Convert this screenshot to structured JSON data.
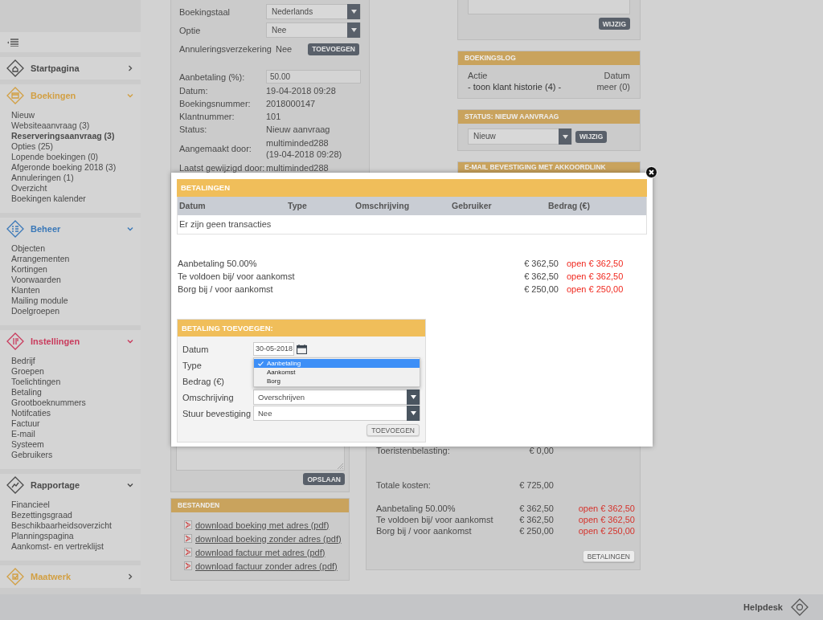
{
  "sidebar": {
    "sections": [
      {
        "title": "Startpagina",
        "color": "#4a4a4a",
        "expanded": false
      },
      {
        "title": "Boekingen",
        "color": "#d29f42",
        "expanded": true,
        "items": [
          {
            "label": "Nieuw",
            "selected": false
          },
          {
            "label": "Websiteaanvraag (3)",
            "selected": false
          },
          {
            "label": "Reserveringsaanvraag (3)",
            "selected": true
          },
          {
            "label": "Opties (25)",
            "selected": false
          },
          {
            "label": "Lopende boekingen (0)",
            "selected": false
          },
          {
            "label": "Afgeronde boeking 2018 (3)",
            "selected": false
          },
          {
            "label": "Annuleringen (1)",
            "selected": false
          },
          {
            "label": "Overzicht",
            "selected": false
          },
          {
            "label": "Boekingen kalender",
            "selected": false
          }
        ]
      },
      {
        "title": "Beheer",
        "color": "#3a78b8",
        "expanded": true,
        "items": [
          {
            "label": "Objecten",
            "selected": false
          },
          {
            "label": "Arrangementen",
            "selected": false
          },
          {
            "label": "Kortingen",
            "selected": false
          },
          {
            "label": "Voorwaarden",
            "selected": false
          },
          {
            "label": "Klanten",
            "selected": false
          },
          {
            "label": "Mailing module",
            "selected": false
          },
          {
            "label": "Doelgroepen",
            "selected": false
          }
        ]
      },
      {
        "title": "Instellingen",
        "color": "#c93a5c",
        "expanded": true,
        "items": [
          {
            "label": "Bedrijf",
            "selected": false
          },
          {
            "label": "Groepen",
            "selected": false
          },
          {
            "label": "Toelichtingen",
            "selected": false
          },
          {
            "label": "Betaling",
            "selected": false
          },
          {
            "label": "Grootboeknummers",
            "selected": false
          },
          {
            "label": "Notifcaties",
            "selected": false
          },
          {
            "label": "Factuur",
            "selected": false
          },
          {
            "label": "E-mail",
            "selected": false
          },
          {
            "label": "Systeem",
            "selected": false
          },
          {
            "label": "Gebruikers",
            "selected": false
          }
        ]
      },
      {
        "title": "Rapportage",
        "color": "#4a4a4a",
        "expanded": true,
        "items": [
          {
            "label": "Financieel",
            "selected": false
          },
          {
            "label": "Bezettingsgraad",
            "selected": false
          },
          {
            "label": "Beschikbaarheidsoverzicht",
            "selected": false
          },
          {
            "label": "Planningspagina",
            "selected": false
          },
          {
            "label": "Aankomst- en vertreklijst",
            "selected": false
          }
        ]
      },
      {
        "title": "Maatwerk",
        "color": "#d29f42",
        "expanded": false
      }
    ]
  },
  "booking_details": {
    "rows": [
      {
        "kind": "select",
        "label": "Boekingstaal",
        "value": "Nederlands"
      },
      {
        "kind": "select",
        "label": "Optie",
        "value": "Nee"
      },
      {
        "kind": "action",
        "label": "Annuleringsverzekering",
        "value": "Nee",
        "button": "TOEVOEGEN"
      },
      {
        "kind": "input",
        "label": "Aanbetaling (%):",
        "value": "50.00"
      },
      {
        "kind": "text",
        "label": "Datum:",
        "value": "19-04-2018 09:28"
      },
      {
        "kind": "text",
        "label": "Boekingsnummer:",
        "value": "2018000147"
      },
      {
        "kind": "text",
        "label": "Klantnummer:",
        "value": "101"
      },
      {
        "kind": "text",
        "label": "Status:",
        "value": "Nieuw aanvraag"
      },
      {
        "kind": "note",
        "label": "Aangemaakt door:",
        "value": "multiminded288",
        "note": "(19-04-2018 09:28)"
      },
      {
        "kind": "text",
        "label": "Laatst gewijzigd door:",
        "value": "multiminded288"
      }
    ]
  },
  "notes_panel": {
    "button": "WIJZIG"
  },
  "booking_log": {
    "title": "BOEKINGSLOG",
    "columns": [
      "Actie",
      "Datum"
    ],
    "row": [
      "- toon klant historie (4) -",
      "meer (0)"
    ]
  },
  "status_panel": {
    "title": "STATUS: NIEUW AANVRAAG",
    "value": "Nieuw",
    "button": "WIJZIG"
  },
  "email_panel": {
    "title": "E-MAIL BEVESTIGING MET AKKOORDLINK"
  },
  "comment_panel": {
    "button": "OPSLAAN"
  },
  "files_panel": {
    "title": "BESTANDEN",
    "links": [
      "download boeking met adres (pdf)",
      "download boeking zonder adres (pdf)",
      "download factuur met adres (pdf)",
      "download factuur zonder adres (pdf)"
    ]
  },
  "costs_panel": {
    "rows": [
      {
        "label": "Toeristenbelasting:",
        "amount": "€ 0,00"
      },
      {
        "label": "Totale kosten:",
        "amount": "€ 725,00"
      }
    ],
    "payments": [
      {
        "label": "Aanbetaling 50.00%",
        "amount": "€ 362,50",
        "open": "open € 362,50"
      },
      {
        "label": "Te voldoen bij/ voor aankomst",
        "amount": "€ 362,50",
        "open": "open € 362,50"
      },
      {
        "label": "Borg bij / voor aankomst",
        "amount": "€ 250,00",
        "open": "open € 250,00"
      }
    ],
    "button": "BETALINGEN"
  },
  "modal": {
    "title": "BETALINGEN",
    "columns": [
      "Datum",
      "Type",
      "Omschrijving",
      "Gebruiker",
      "Bedrag (€)"
    ],
    "empty_message": "Er zijn geen transacties",
    "payments": [
      {
        "label": "Aanbetaling 50.00%",
        "amount": "€ 362,50",
        "open": "open € 362,50"
      },
      {
        "label": "Te voldoen bij/ voor aankomst",
        "amount": "€ 362,50",
        "open": "open € 362,50"
      },
      {
        "label": "Borg bij / voor aankomst",
        "amount": "€ 250,00",
        "open": "open € 250,00"
      }
    ],
    "form": {
      "title": "BETALING TOEVOEGEN:",
      "fields": [
        {
          "kind": "date",
          "label": "Datum",
          "value": "30-05-2018"
        },
        {
          "kind": "open_select",
          "label": "Type",
          "options": [
            {
              "label": "Aanbetaling",
              "selected": true
            },
            {
              "label": "Aankomst",
              "selected": false
            },
            {
              "label": "Borg",
              "selected": false
            }
          ]
        },
        {
          "kind": "covered",
          "label": "Bedrag (€)"
        },
        {
          "kind": "select",
          "label": "Omschrijving",
          "value": "Overschrijven"
        },
        {
          "kind": "select",
          "label": "Stuur bevestiging",
          "value": "Nee"
        }
      ],
      "button": "TOEVOEGEN"
    }
  },
  "footer": {
    "helpdesk": "Helpdesk"
  }
}
